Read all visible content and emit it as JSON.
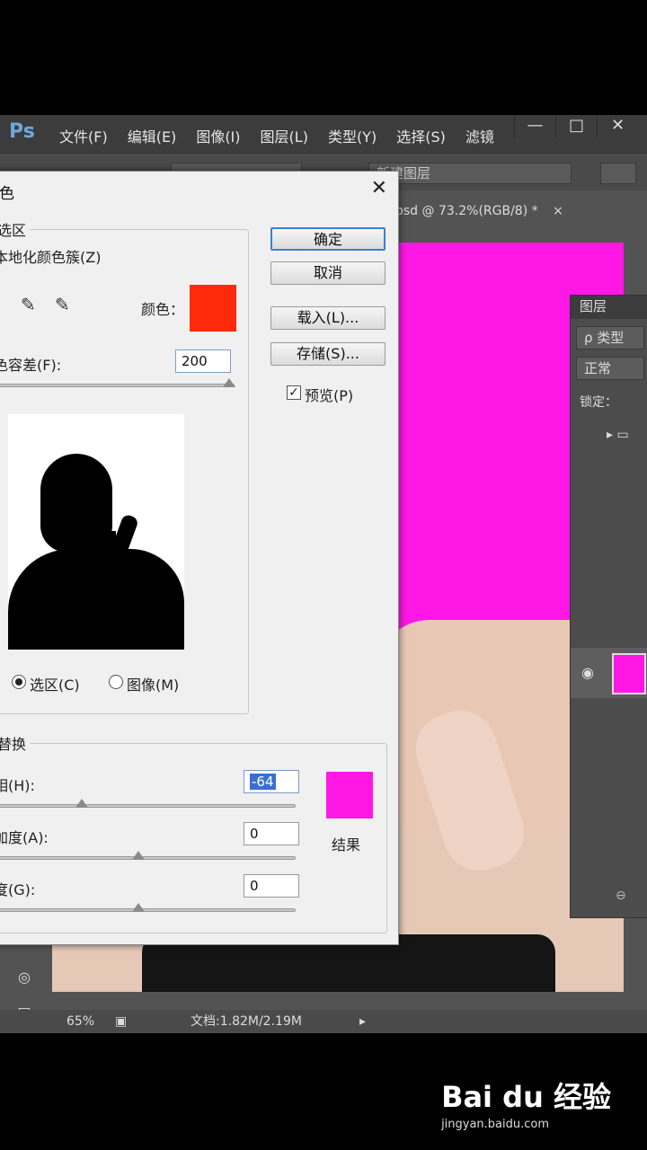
{
  "app": {
    "logo": "Ps",
    "menu": [
      "文件(F)",
      "编辑(E)",
      "图像(I)",
      "图层(L)",
      "类型(Y)",
      "选择(S)",
      "滤镜"
    ],
    "window_controls": [
      "—",
      "□",
      "✕"
    ]
  },
  "options_bar": {
    "mode_field": "新建图层"
  },
  "document": {
    "tab_title": "psd @ 73.2%(RGB/8) *",
    "tab_close": "×",
    "background_color": "#ff17e6"
  },
  "layers_panel": {
    "tab": "图层",
    "search": "ρ 类型",
    "blend_mode": "正常",
    "lock_label": "锁定："
  },
  "status_bar": {
    "zoom": "65%",
    "doc_info": "文档:1.82M/2.19M"
  },
  "dialog": {
    "title": "色",
    "close": "✕",
    "selection_group": "选区",
    "localized_clusters": "本地化颜色簇(Z)",
    "color_label": "颜色：",
    "color_swatch": "#ff2a0a",
    "fuzziness_label": "色容差(F):",
    "fuzziness_value": "200",
    "fuzziness_fraction": 1.0,
    "view_options": {
      "selection": "选区(C)",
      "image": "图像(M)",
      "selected": "selection"
    },
    "replacement_group": "替换",
    "hue_label": "相(H):",
    "hue_value": "-64",
    "saturation_label": "加度(A):",
    "saturation_value": "0",
    "lightness_label": "度(G):",
    "lightness_value": "0",
    "result_label": "结果",
    "result_swatch": "#ff17e6",
    "buttons": {
      "ok": "确定",
      "cancel": "取消",
      "load": "载入(L)...",
      "save": "存储(S)..."
    },
    "preview_label": "预览(P)",
    "preview_checked": true
  },
  "watermark": {
    "logo": "Bai du 经验",
    "url": "jingyan.baidu.com"
  }
}
